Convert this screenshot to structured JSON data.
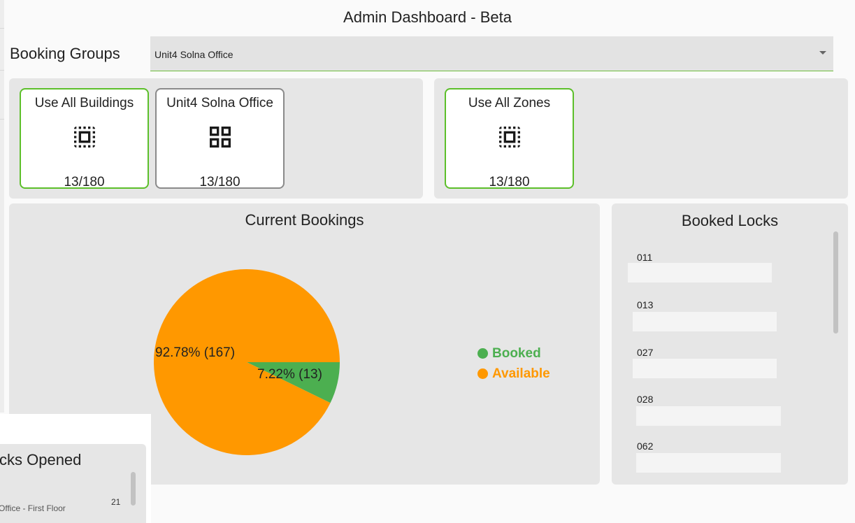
{
  "header": {
    "title": "Admin Dashboard - Beta"
  },
  "booking_groups": {
    "label": "Booking Groups",
    "selected": "Unit4 Solna Office"
  },
  "buildings": [
    {
      "label": "Use All Buildings",
      "count": "13/180",
      "icon": "select-all-icon",
      "selected": true
    },
    {
      "label": "Unit4 Solna Office",
      "count": "13/180",
      "icon": "grid-view-icon",
      "selected": false
    }
  ],
  "zones": [
    {
      "label": "Use All Zones",
      "count": "13/180",
      "icon": "select-all-icon",
      "selected": true
    }
  ],
  "current_bookings": {
    "title": "Current Bookings",
    "legend": [
      {
        "label": "Booked",
        "color": "#4caf50"
      },
      {
        "label": "Available",
        "color": "#ff9800"
      }
    ],
    "slice_labels": {
      "available": "92.78% (167)",
      "booked": "7.22% (13)"
    }
  },
  "chart_data": {
    "type": "pie",
    "title": "Current Bookings",
    "categories": [
      "Booked",
      "Available"
    ],
    "values": [
      13,
      167
    ],
    "percentages": [
      7.22,
      92.78
    ],
    "colors": [
      "#4caf50",
      "#ff9800"
    ],
    "legend_position": "right"
  },
  "booked_locks": {
    "title": "Booked Locks",
    "items": [
      "011",
      "013",
      "027",
      "028",
      "062"
    ]
  },
  "locks_opened": {
    "title": "cks Opened",
    "row_label": "Office - First Floor",
    "row_count": "21"
  }
}
